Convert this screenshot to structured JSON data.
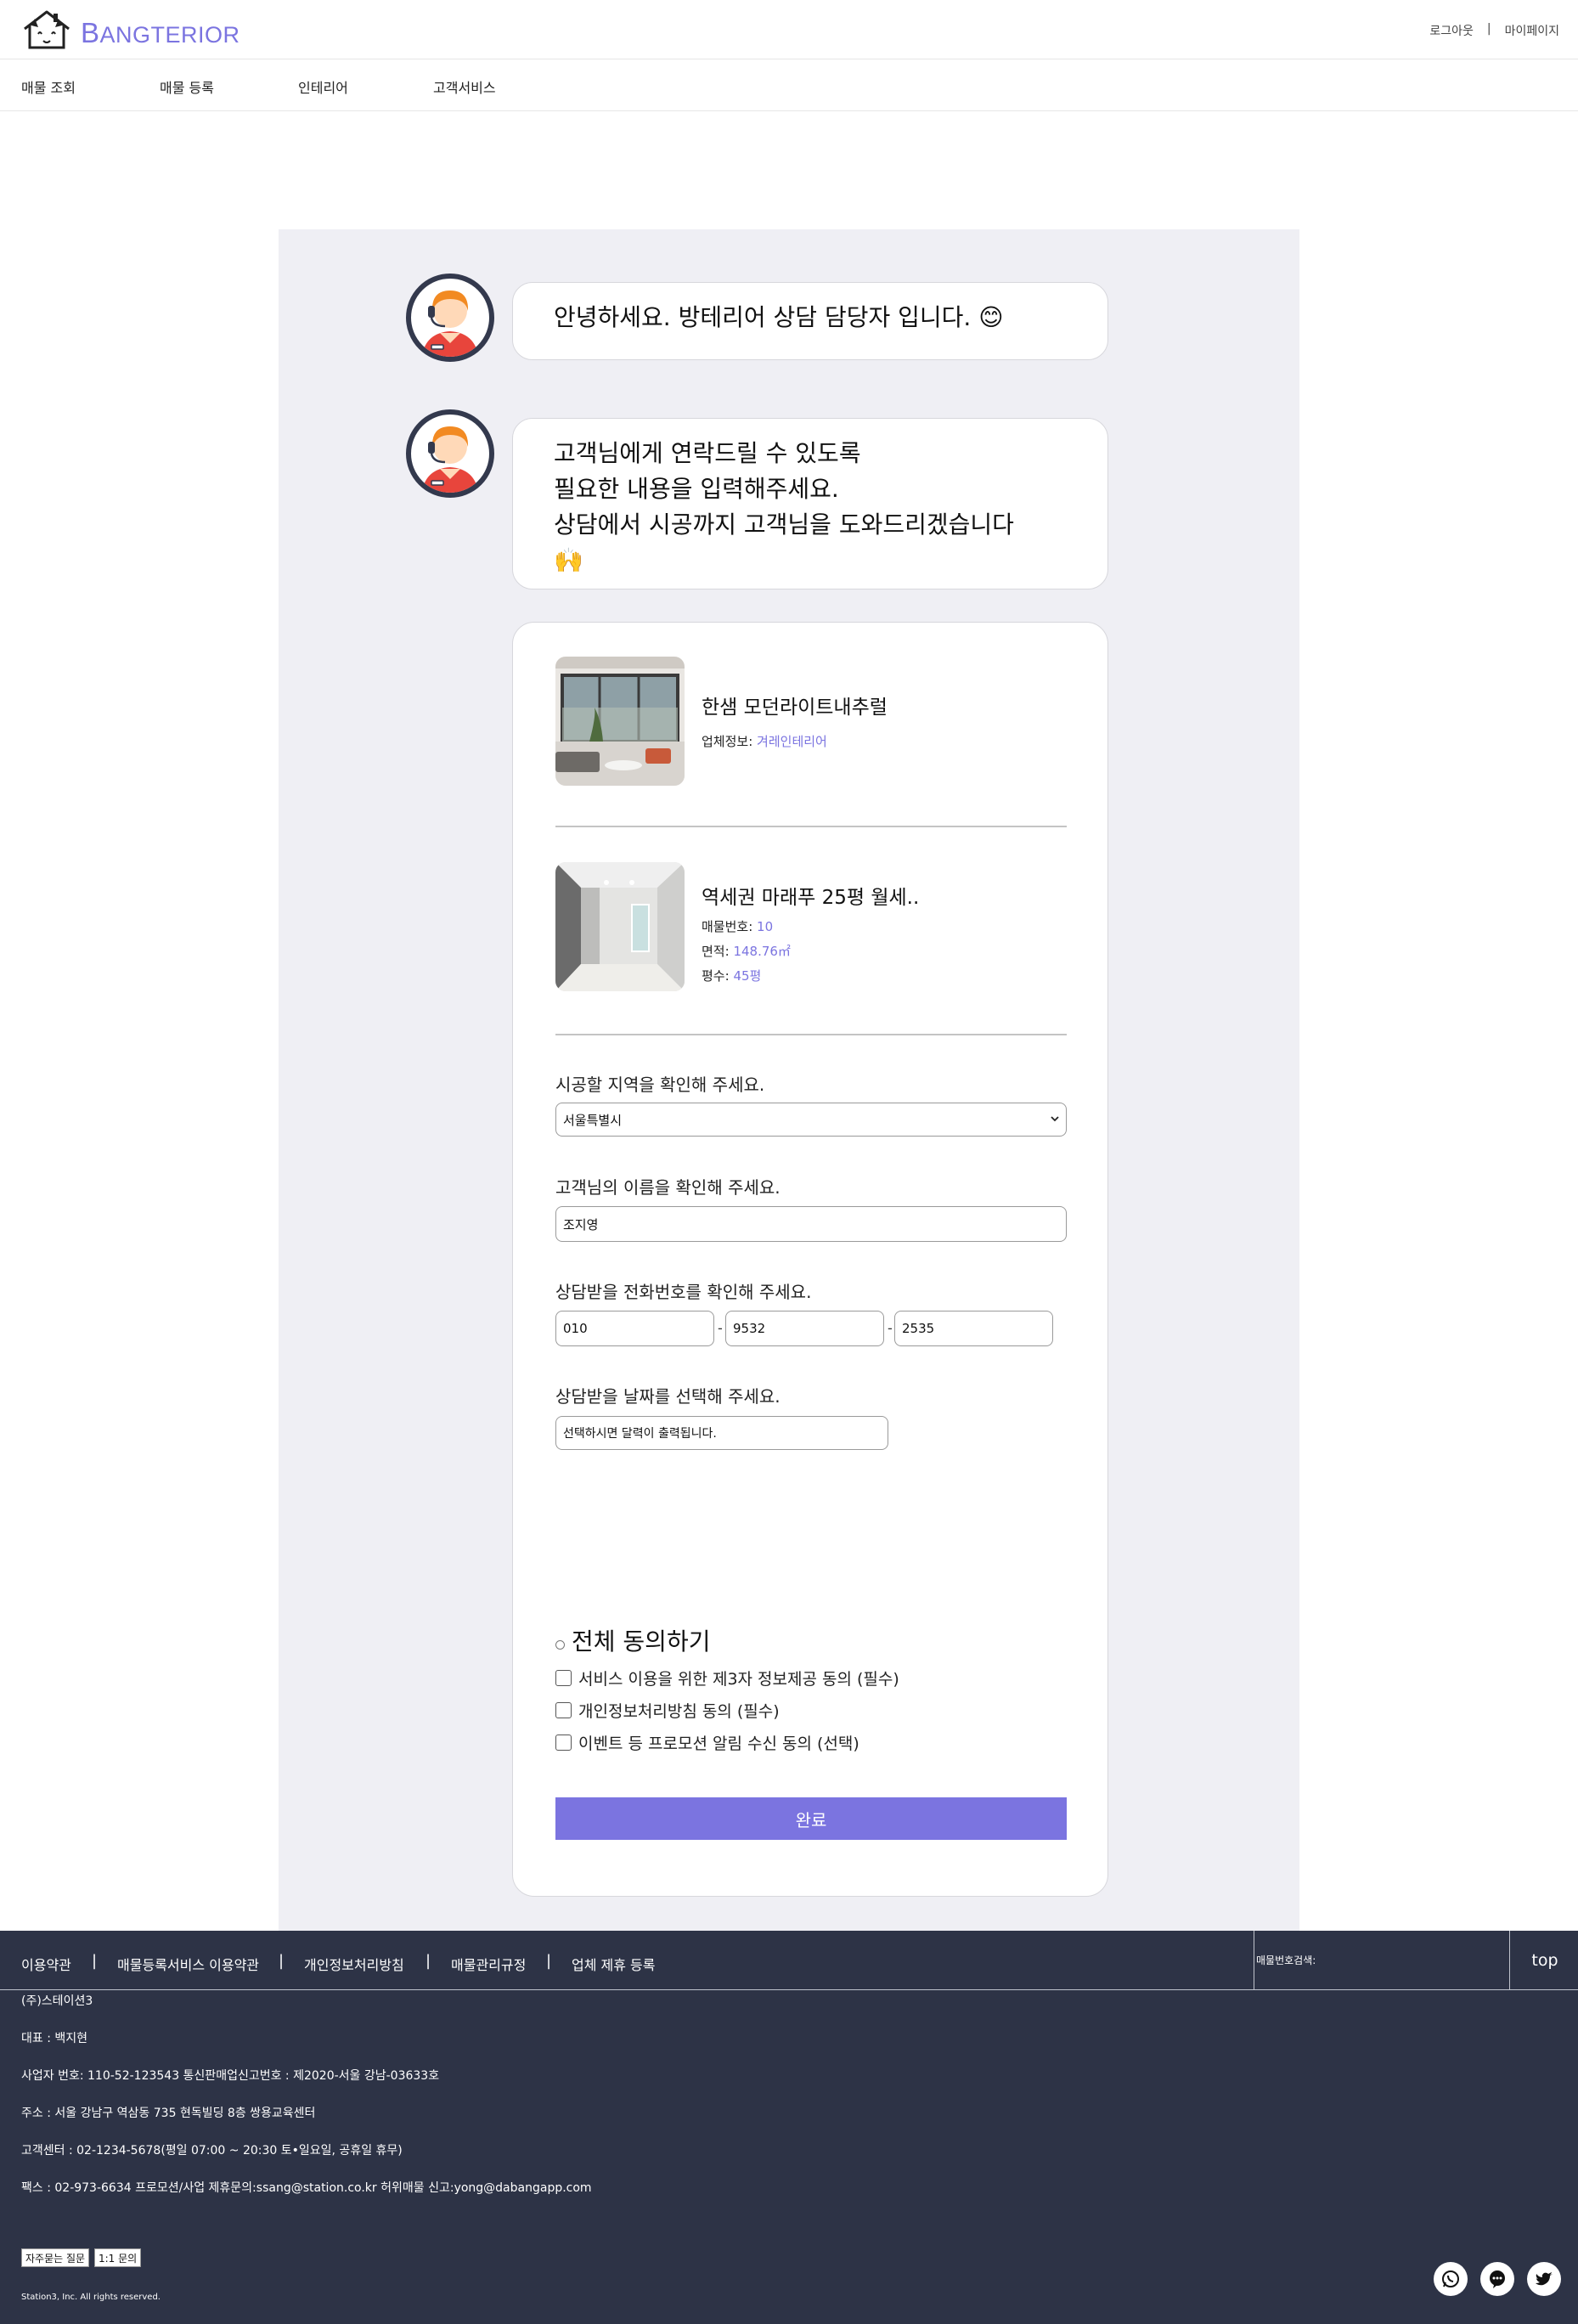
{
  "header": {
    "logo_text_first": "B",
    "logo_text_rest": "ANGTERIOR",
    "logout": "로그아웃",
    "separator": "|",
    "mypage": "마이페이지"
  },
  "nav": [
    "매물 조회",
    "매물 등록",
    "인테리어",
    "고객서비스"
  ],
  "chat": {
    "greeting": "안녕하세요. 방테리어 상담 담당자 입니다. 😊",
    "instruction_1": "고객님에게 연락드릴 수 있도록",
    "instruction_2": "필요한 내용을 입력해주세요.",
    "instruction_3": "상담에서 시공까지 고객님을 도와드리겠습니다",
    "instruction_4": "🙌"
  },
  "interior_item": {
    "title": "한샘 모던라이트내추럴",
    "company_label": "업체정보:",
    "company_value": "겨레인테리어"
  },
  "property_item": {
    "title": "역세권 마래푸 25평 월세..",
    "number_label": "매물번호:",
    "number_value": "10",
    "area_label": "면적:",
    "area_value": "148.76㎡",
    "pyeong_label": "평수:",
    "pyeong_value": "45평"
  },
  "form": {
    "region_label": "시공할 지역을 확인해 주세요.",
    "region_value": "서울특별시",
    "name_label": "고객님의 이름을 확인해 주세요.",
    "name_value": "조지영",
    "phone_label": "상담받을 전화번호를 확인해 주세요.",
    "phone_1": "010",
    "phone_2": "9532",
    "phone_3": "2535",
    "phone_dash": "-",
    "date_label": "상담받을 날짜를 선택해 주세요.",
    "date_placeholder": "선택하시면 달력이 출력됩니다."
  },
  "agreement": {
    "all": "전체 동의하기",
    "items": [
      "서비스 이용을 위한 제3자 정보제공 동의 (필수)",
      "개인정보처리방침 동의 (필수)",
      "이벤트 등 프로모션 알림 수신 동의 (선택)"
    ]
  },
  "submit_label": "완료",
  "footer": {
    "links": [
      "이용약관",
      "매물등록서비스 이용약관",
      "개인정보처리방침",
      "매물관리규정",
      "업체 제휴 등록"
    ],
    "separator": "|",
    "search_label": "매물번호검색:",
    "top": "top",
    "company": "(주)스테이션3",
    "ceo": "대표 : 백지현",
    "business": "사업자 번호: 110-52-123543 통신판매업신고번호 : 제2020-서울 강남-03633호",
    "address": "주소 : 서울 강남구 역삼동 735 현독빌딩 8층 쌍용교육센터",
    "cs": "고객센터 : 02-1234-5678(평일 07:00 ~ 20:30 토•일요일, 공휴일 휴무)",
    "fax": "팩스 : 02-973-6634  프로모션/사업 제휴문의:ssang@station.co.kr  허위매물 신고:yong@dabangapp.com",
    "faq": "자주묻는 질문",
    "inquiry": "1:1 문의",
    "copyright": "Station3, Inc. All rights reserved."
  },
  "colors": {
    "accent": "#7b74e0",
    "panel_bg": "#efeff4",
    "footer_bg": "#2d3346"
  },
  "icons": [
    "house-logo-icon",
    "agent-avatar-icon",
    "whatsapp-icon",
    "chat-icon",
    "twitter-icon"
  ]
}
